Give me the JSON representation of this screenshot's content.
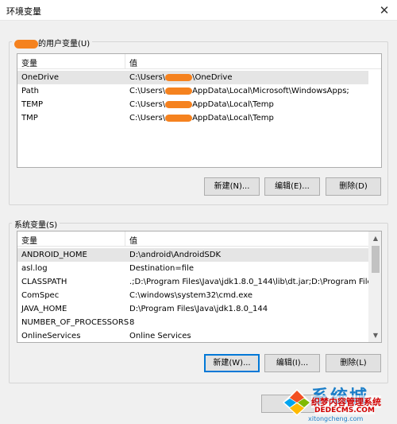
{
  "window": {
    "title": "环境变量"
  },
  "user_section": {
    "label": "的用户变量(U)",
    "header": {
      "name": "变量",
      "value": "值"
    },
    "rows": [
      {
        "name": "OneDrive",
        "value_prefix": "C:\\Users\\",
        "value_suffix": "\\OneDrive"
      },
      {
        "name": "Path",
        "value_prefix": "C:\\Users\\",
        "value_suffix": "AppData\\Local\\Microsoft\\WindowsApps;"
      },
      {
        "name": "TEMP",
        "value_prefix": "C:\\Users\\",
        "value_suffix": "AppData\\Local\\Temp"
      },
      {
        "name": "TMP",
        "value_prefix": "C:\\Users\\",
        "value_suffix": "AppData\\Local\\Temp"
      }
    ],
    "buttons": {
      "new": "新建(N)...",
      "edit": "编辑(E)...",
      "delete": "删除(D)"
    }
  },
  "system_section": {
    "label": "系统变量(S)",
    "header": {
      "name": "变量",
      "value": "值"
    },
    "rows": [
      {
        "name": "ANDROID_HOME",
        "value": "D:\\android\\AndroidSDK"
      },
      {
        "name": "asl.log",
        "value": "Destination=file"
      },
      {
        "name": "CLASSPATH",
        "value": ".;D:\\Program Files\\Java\\jdk1.8.0_144\\lib\\dt.jar;D:\\Program File..."
      },
      {
        "name": "ComSpec",
        "value": "C:\\windows\\system32\\cmd.exe"
      },
      {
        "name": "JAVA_HOME",
        "value": "D:\\Program Files\\Java\\jdk1.8.0_144"
      },
      {
        "name": "NUMBER_OF_PROCESSORS",
        "value": "8"
      },
      {
        "name": "OnlineServices",
        "value": "Online Services"
      }
    ],
    "buttons": {
      "new": "新建(W)...",
      "edit": "编辑(I)...",
      "delete": "删除(L)"
    }
  },
  "watermark": {
    "big_text": "系统城",
    "cn_text": "织梦内容管理系统",
    "url_text": "DEDECMS.COM",
    "sub_text": "xitongcheng.com",
    "logo_colors": [
      "#f25022",
      "#7fba00",
      "#00a4ef",
      "#ffb900"
    ]
  },
  "colors": {
    "redaction": "#f5821f",
    "selected_row": "#e5e5e5",
    "default_button_border": "#0078d7"
  }
}
